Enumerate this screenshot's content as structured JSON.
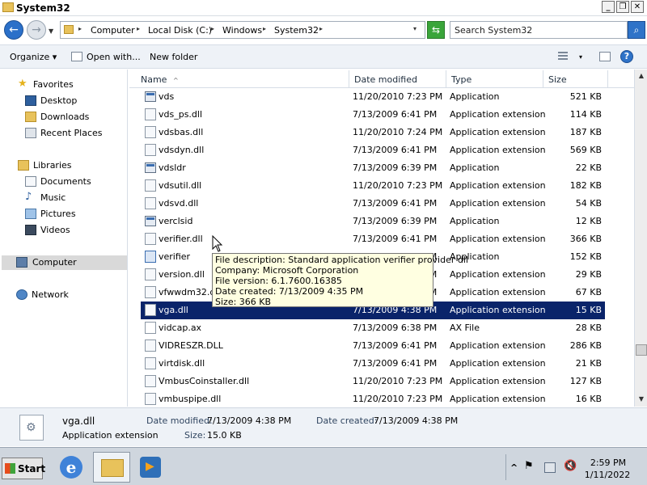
{
  "window": {
    "title": "System32",
    "min_label": "_",
    "max_label": "❐",
    "close_label": "✕"
  },
  "nav": {
    "back_label": "←",
    "forward_label": "→",
    "history_label": "▼",
    "refresh_label": "⇆",
    "search_icon": "search-icon"
  },
  "address": {
    "crumbs": [
      "Computer",
      "Local Disk (C:)",
      "Windows",
      "System32"
    ],
    "sep": "▸",
    "dropdown": "▾"
  },
  "search": {
    "placeholder": "Search System32"
  },
  "toolbar": {
    "organize": "Organize",
    "open_with": "Open with...",
    "new_folder": "New folder",
    "arrow": "▾",
    "help": "?"
  },
  "sidebar": {
    "favorites": "Favorites",
    "desktop": "Desktop",
    "downloads": "Downloads",
    "recent_places": "Recent Places",
    "libraries": "Libraries",
    "documents": "Documents",
    "music": "Music",
    "pictures": "Pictures",
    "videos": "Videos",
    "computer": "Computer",
    "network": "Network"
  },
  "columns": {
    "name": "Name",
    "date_modified": "Date modified",
    "type": "Type",
    "size": "Size",
    "sort_indicator": "^"
  },
  "files": [
    {
      "name": "vds",
      "date": "11/20/2010 7:23 PM",
      "type": "Application",
      "size": "521 KB",
      "kind": "app"
    },
    {
      "name": "vds_ps.dll",
      "date": "7/13/2009 6:41 PM",
      "type": "Application extension",
      "size": "114 KB",
      "kind": "dll"
    },
    {
      "name": "vdsbas.dll",
      "date": "11/20/2010 7:24 PM",
      "type": "Application extension",
      "size": "187 KB",
      "kind": "dll"
    },
    {
      "name": "vdsdyn.dll",
      "date": "7/13/2009 6:41 PM",
      "type": "Application extension",
      "size": "569 KB",
      "kind": "dll"
    },
    {
      "name": "vdsldr",
      "date": "7/13/2009 6:39 PM",
      "type": "Application",
      "size": "22 KB",
      "kind": "app"
    },
    {
      "name": "vdsutil.dll",
      "date": "11/20/2010 7:23 PM",
      "type": "Application extension",
      "size": "182 KB",
      "kind": "dll"
    },
    {
      "name": "vdsvd.dll",
      "date": "7/13/2009 6:41 PM",
      "type": "Application extension",
      "size": "54 KB",
      "kind": "dll"
    },
    {
      "name": "verclsid",
      "date": "7/13/2009 6:39 PM",
      "type": "Application",
      "size": "12 KB",
      "kind": "app"
    },
    {
      "name": "verifier.dll",
      "date": "7/13/2009 6:41 PM",
      "type": "Application extension",
      "size": "366 KB",
      "kind": "dll"
    },
    {
      "name": "verifier",
      "date": "7/13/2009 6:39 PM",
      "type": "Application",
      "size": "152 KB",
      "kind": "verifier"
    },
    {
      "name": "version.dll",
      "date": "7/13/2009 6:41 PM",
      "type": "Application extension",
      "size": "29 KB",
      "kind": "dll"
    },
    {
      "name": "vfwwdm32.dll",
      "date": "7/13/2009 6:41 PM",
      "type": "Application extension",
      "size": "67 KB",
      "kind": "dll"
    },
    {
      "name": "vga.dll",
      "date": "7/13/2009 4:38 PM",
      "type": "Application extension",
      "size": "15 KB",
      "kind": "dll",
      "selected": true
    },
    {
      "name": "vidcap.ax",
      "date": "7/13/2009 6:38 PM",
      "type": "AX File",
      "size": "28 KB",
      "kind": "ax"
    },
    {
      "name": "VIDRESZR.DLL",
      "date": "7/13/2009 6:41 PM",
      "type": "Application extension",
      "size": "286 KB",
      "kind": "dll"
    },
    {
      "name": "virtdisk.dll",
      "date": "7/13/2009 6:41 PM",
      "type": "Application extension",
      "size": "21 KB",
      "kind": "dll"
    },
    {
      "name": "VmbusCoinstaller.dll",
      "date": "11/20/2010 7:23 PM",
      "type": "Application extension",
      "size": "127 KB",
      "kind": "dll"
    },
    {
      "name": "vmbuspipe.dll",
      "date": "11/20/2010 7:23 PM",
      "type": "Application extension",
      "size": "16 KB",
      "kind": "dll"
    }
  ],
  "tooltip": {
    "line1": "File description: Standard application verifier provider dll",
    "line2": "Company: Microsoft Corporation",
    "line3": "File version: 6.1.7600.16385",
    "line4": "Date created: 7/13/2009 4:35 PM",
    "line5": "Size: 366 KB"
  },
  "scrollbar": {
    "up": "▲",
    "down": "▼"
  },
  "details": {
    "name": "vga.dll",
    "type": "Application extension",
    "date_modified_label": "Date modified:",
    "date_modified": "7/13/2009 4:38 PM",
    "date_created_label": "Date created:",
    "date_created": "7/13/2009 4:38 PM",
    "size_label": "Size:",
    "size": "15.0 KB"
  },
  "taskbar": {
    "start": "Start",
    "ie": "e",
    "tray_chevron": "^",
    "clock_time": "2:59 PM",
    "clock_date": "1/11/2022"
  },
  "colors": {
    "selection": "#0a246a",
    "tooltip_bg": "#ffffe1",
    "back_button": "#2b70c9"
  }
}
